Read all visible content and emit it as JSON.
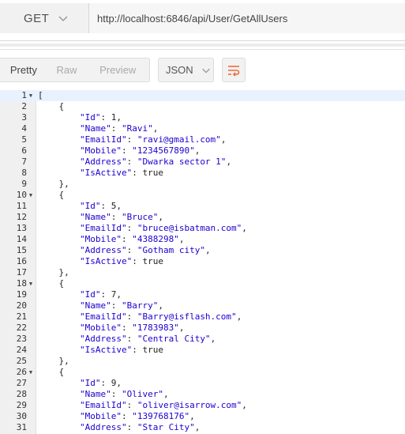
{
  "request": {
    "method": "GET",
    "url": "http://localhost:6846/api/User/GetAllUsers"
  },
  "response_toolbar": {
    "views": [
      "Pretty",
      "Raw",
      "Preview"
    ],
    "active_view": "Pretty",
    "format": "JSON",
    "wrap_icon": "wrap-lines-icon"
  },
  "colors": {
    "accent": "#f26b3a",
    "json_key": "#1c00cf"
  },
  "code": {
    "lines": [
      {
        "n": "1",
        "fold": true,
        "text": "["
      },
      {
        "n": "2",
        "text": "    {"
      },
      {
        "n": "3",
        "text": "        \"Id\": 1,"
      },
      {
        "n": "4",
        "text": "        \"Name\": \"Ravi\","
      },
      {
        "n": "5",
        "text": "        \"EmailId\": \"ravi@gmail.com\","
      },
      {
        "n": "6",
        "text": "        \"Mobile\": \"1234567890\","
      },
      {
        "n": "7",
        "text": "        \"Address\": \"Dwarka sector 1\","
      },
      {
        "n": "8",
        "text": "        \"IsActive\": true"
      },
      {
        "n": "9",
        "text": "    },"
      },
      {
        "n": "10",
        "fold": true,
        "text": "    {"
      },
      {
        "n": "11",
        "text": "        \"Id\": 5,"
      },
      {
        "n": "12",
        "text": "        \"Name\": \"Bruce\","
      },
      {
        "n": "13",
        "text": "        \"EmailId\": \"bruce@isbatman.com\","
      },
      {
        "n": "14",
        "text": "        \"Mobile\": \"4388298\","
      },
      {
        "n": "15",
        "text": "        \"Address\": \"Gotham city\","
      },
      {
        "n": "16",
        "text": "        \"IsActive\": true"
      },
      {
        "n": "17",
        "text": "    },"
      },
      {
        "n": "18",
        "fold": true,
        "text": "    {"
      },
      {
        "n": "19",
        "text": "        \"Id\": 7,"
      },
      {
        "n": "20",
        "text": "        \"Name\": \"Barry\","
      },
      {
        "n": "21",
        "text": "        \"EmailId\": \"Barry@isflash.com\","
      },
      {
        "n": "22",
        "text": "        \"Mobile\": \"1783983\","
      },
      {
        "n": "23",
        "text": "        \"Address\": \"Central City\","
      },
      {
        "n": "24",
        "text": "        \"IsActive\": true"
      },
      {
        "n": "25",
        "text": "    },"
      },
      {
        "n": "26",
        "fold": true,
        "text": "    {"
      },
      {
        "n": "27",
        "text": "        \"Id\": 9,"
      },
      {
        "n": "28",
        "text": "        \"Name\": \"Oliver\","
      },
      {
        "n": "29",
        "text": "        \"EmailId\": \"oliver@isarrow.com\","
      },
      {
        "n": "30",
        "text": "        \"Mobile\": \"139768176\","
      },
      {
        "n": "31",
        "text": "        \"Address\": \"Star City\","
      }
    ]
  }
}
